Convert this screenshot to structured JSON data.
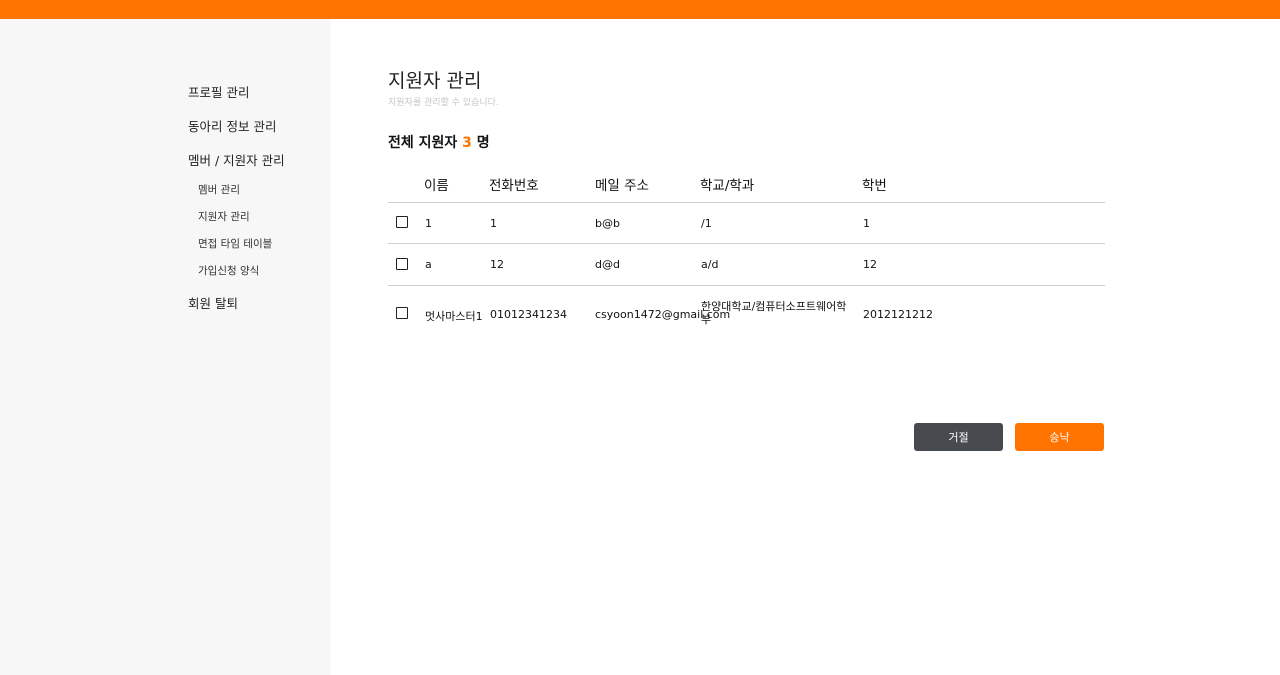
{
  "colors": {
    "accent": "#ff7300",
    "sidebar_bg": "#f7f7f7",
    "reject_button": "#474a4f"
  },
  "sidebar": {
    "items": [
      {
        "label": "프로필 관리"
      },
      {
        "label": "동아리 정보 관리"
      },
      {
        "label": "멤버 / 지원자 관리"
      },
      {
        "label": "회원 탈퇴"
      }
    ],
    "sub_items": [
      {
        "label": "멤버 관리"
      },
      {
        "label": "지원자 관리"
      },
      {
        "label": "면접 타임 테이블"
      },
      {
        "label": "가입신청 양식"
      }
    ]
  },
  "main": {
    "title": "지원자 관리",
    "subtitle": "지원자를 관리할 수 있습니다.",
    "total_prefix": "전체 지원자 ",
    "total_count": "3",
    "total_suffix": " 명"
  },
  "table": {
    "headers": [
      "이름",
      "전화번호",
      "메일 주소",
      "학교/학과",
      "학번"
    ],
    "rows": [
      [
        "1",
        "1",
        "b@b",
        "/1",
        "1"
      ],
      [
        "a",
        "12",
        "d@d",
        "a/d",
        "12"
      ],
      [
        "멋사마스터1",
        "01012341234",
        "csyoon1472@gmail.com",
        "한양대학교/컴퓨터소프트웨어학부",
        "2012121212"
      ]
    ]
  },
  "buttons": {
    "reject": "거절",
    "approve": "승낙"
  }
}
